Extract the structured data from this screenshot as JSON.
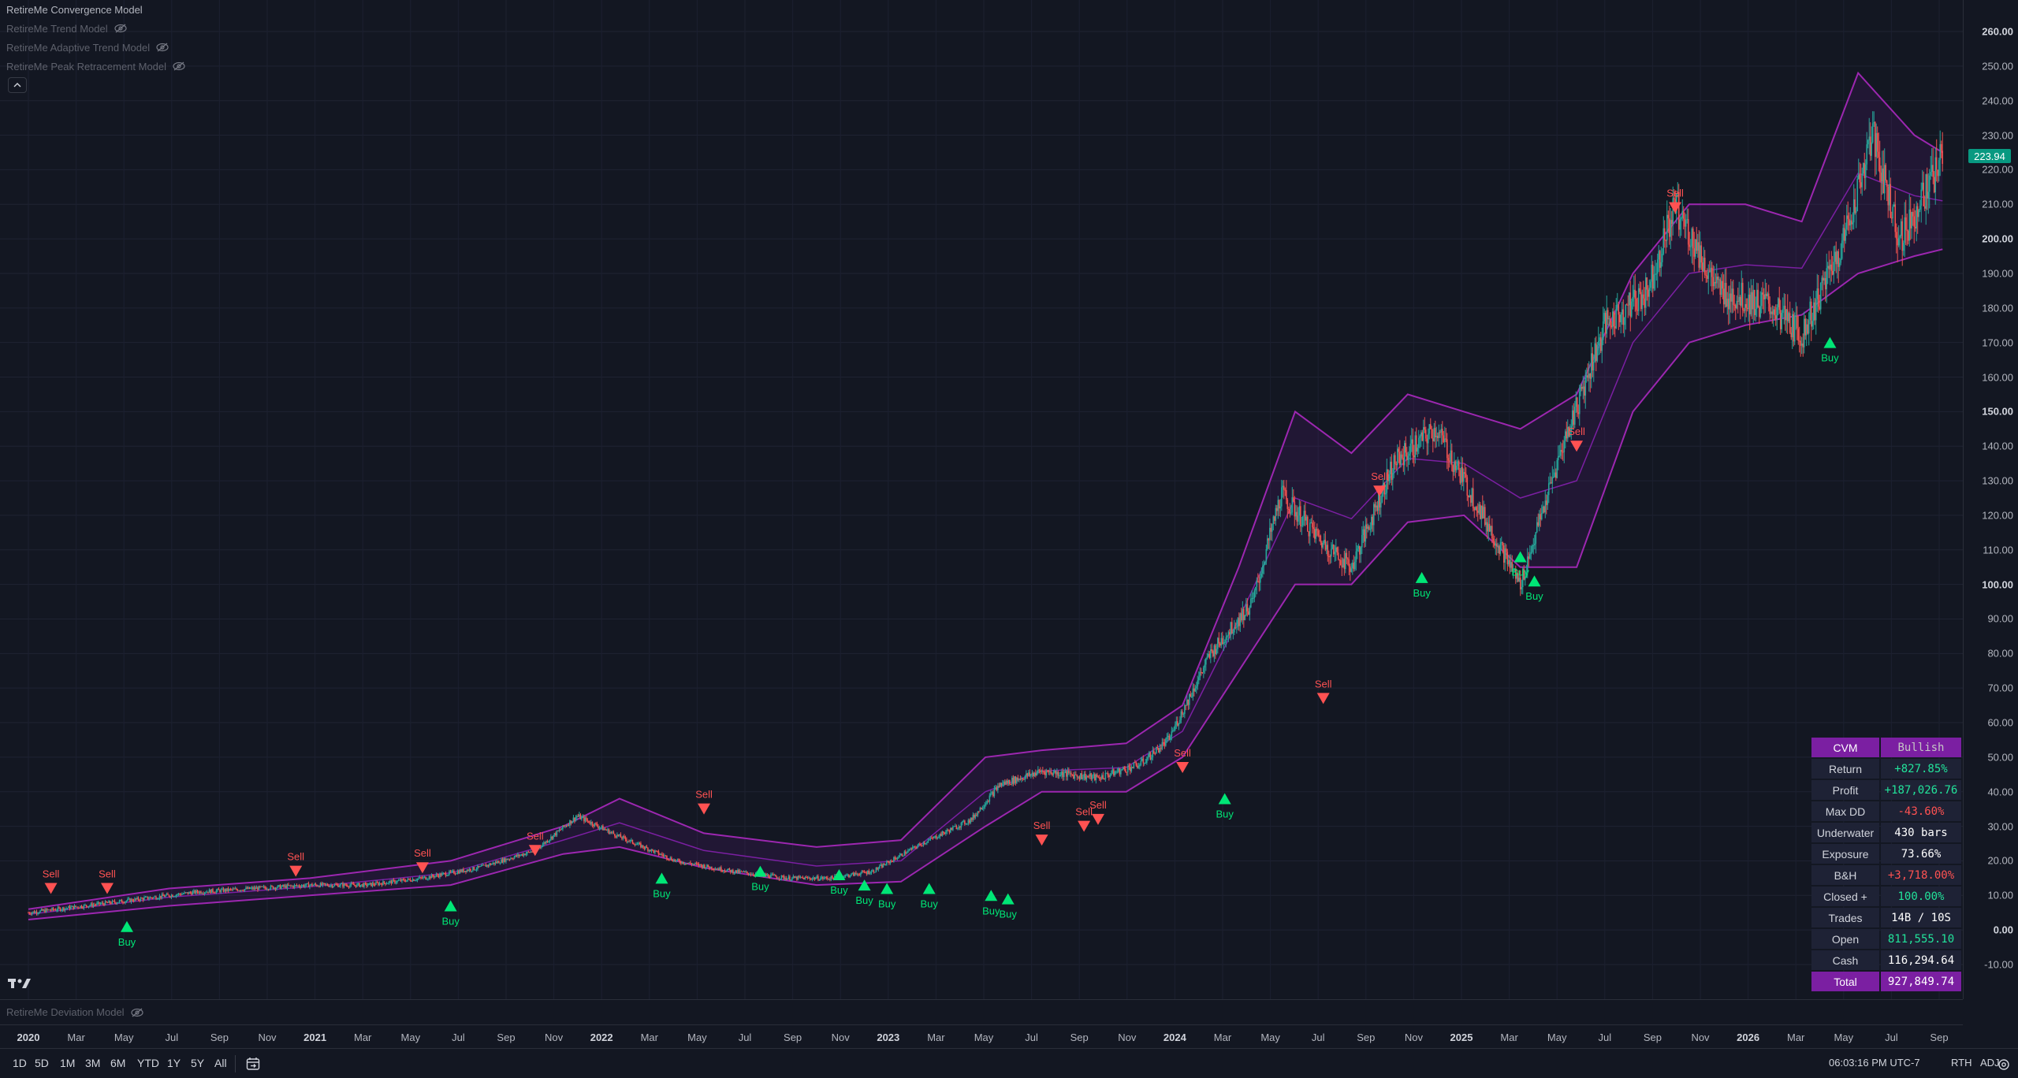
{
  "legend": {
    "main": "RetireMe Convergence Model",
    "hidden": [
      "RetireMe Trend Model",
      "RetireMe Adaptive Trend Model",
      "RetireMe Peak Retracement Model"
    ]
  },
  "sub_pane_label": "RetireMe Deviation Model",
  "current_price": "223.94",
  "price_axis": [
    "260.00",
    "250.00",
    "240.00",
    "230.00",
    "220.00",
    "210.00",
    "200.00",
    "190.00",
    "180.00",
    "170.00",
    "160.00",
    "150.00",
    "140.00",
    "130.00",
    "120.00",
    "110.00",
    "100.00",
    "90.00",
    "80.00",
    "70.00",
    "60.00",
    "50.00",
    "40.00",
    "30.00",
    "20.00",
    "10.00",
    "0.00",
    "-10.00"
  ],
  "time_axis": [
    {
      "t": "2020",
      "b": true
    },
    {
      "t": "Mar"
    },
    {
      "t": "May"
    },
    {
      "t": "Jul"
    },
    {
      "t": "Sep"
    },
    {
      "t": "Nov"
    },
    {
      "t": "2021",
      "b": true
    },
    {
      "t": "Mar"
    },
    {
      "t": "May"
    },
    {
      "t": "Jul"
    },
    {
      "t": "Sep"
    },
    {
      "t": "Nov"
    },
    {
      "t": "2022",
      "b": true
    },
    {
      "t": "Mar"
    },
    {
      "t": "May"
    },
    {
      "t": "Jul"
    },
    {
      "t": "Sep"
    },
    {
      "t": "Nov"
    },
    {
      "t": "2023",
      "b": true
    },
    {
      "t": "Mar"
    },
    {
      "t": "May"
    },
    {
      "t": "Jul"
    },
    {
      "t": "Sep"
    },
    {
      "t": "Nov"
    },
    {
      "t": "2024",
      "b": true
    },
    {
      "t": "Mar"
    },
    {
      "t": "May"
    },
    {
      "t": "Jul"
    },
    {
      "t": "Sep"
    },
    {
      "t": "Nov"
    },
    {
      "t": "2025",
      "b": true
    },
    {
      "t": "Mar"
    },
    {
      "t": "May"
    },
    {
      "t": "Jul"
    },
    {
      "t": "Sep"
    },
    {
      "t": "Nov"
    },
    {
      "t": "2026",
      "b": true
    },
    {
      "t": "Mar"
    },
    {
      "t": "May"
    },
    {
      "t": "Jul"
    },
    {
      "t": "Sep"
    }
  ],
  "timeframes": [
    "1D",
    "5D",
    "1M",
    "3M",
    "6M",
    "YTD",
    "1Y",
    "5Y",
    "All"
  ],
  "status": {
    "clock": "06:03:16 PM UTC-7",
    "session": "RTH",
    "adj": "ADJ"
  },
  "stats": {
    "head": [
      "CVM",
      "Bullish"
    ],
    "rows": [
      {
        "label": "Return",
        "value": "+827.85%",
        "tone": "pos"
      },
      {
        "label": "Profit",
        "value": "+187,026.76",
        "tone": "pos"
      },
      {
        "label": "Max DD",
        "value": "-43.60%",
        "tone": "neg"
      },
      {
        "label": "Underwater",
        "value": "430 bars",
        "tone": "neutral"
      },
      {
        "label": "Exposure",
        "value": "73.66%",
        "tone": "neutral"
      },
      {
        "label": "B&H",
        "value": "+3,718.00%",
        "tone": "neg"
      },
      {
        "label": "Closed +",
        "value": "100.00%",
        "tone": "pos"
      },
      {
        "label": "Trades",
        "value": "14B / 10S",
        "tone": "neutral"
      },
      {
        "label": "Open",
        "value": "811,555.10",
        "tone": "pos"
      },
      {
        "label": "Cash",
        "value": "116,294.64",
        "tone": "neutral"
      }
    ],
    "foot": [
      "Total",
      "927,849.74"
    ]
  },
  "signal_labels": {
    "buy": "Buy",
    "sell": "Sell"
  },
  "chart_data": {
    "type": "line",
    "ylim": [
      -15,
      265
    ],
    "price_path": [
      [
        2020.0,
        5
      ],
      [
        2020.2,
        7
      ],
      [
        2020.4,
        9
      ],
      [
        2020.6,
        11
      ],
      [
        2020.8,
        12
      ],
      [
        2021.0,
        13
      ],
      [
        2021.2,
        13
      ],
      [
        2021.4,
        15
      ],
      [
        2021.6,
        18
      ],
      [
        2021.8,
        23
      ],
      [
        2021.95,
        33
      ],
      [
        2022.1,
        27
      ],
      [
        2022.3,
        20
      ],
      [
        2022.5,
        17
      ],
      [
        2022.7,
        15
      ],
      [
        2022.85,
        15
      ],
      [
        2023.0,
        17
      ],
      [
        2023.15,
        24
      ],
      [
        2023.35,
        32
      ],
      [
        2023.45,
        42
      ],
      [
        2023.6,
        46
      ],
      [
        2023.8,
        44
      ],
      [
        2023.95,
        48
      ],
      [
        2024.05,
        55
      ],
      [
        2024.2,
        80
      ],
      [
        2024.35,
        95
      ],
      [
        2024.45,
        126
      ],
      [
        2024.6,
        112
      ],
      [
        2024.7,
        105
      ],
      [
        2024.85,
        135
      ],
      [
        2025.0,
        145
      ],
      [
        2025.1,
        130
      ],
      [
        2025.2,
        115
      ],
      [
        2025.3,
        100
      ],
      [
        2025.45,
        140
      ],
      [
        2025.6,
        175
      ],
      [
        2025.75,
        185
      ],
      [
        2025.85,
        210
      ],
      [
        2026.0,
        185
      ],
      [
        2026.2,
        180
      ],
      [
        2026.3,
        172
      ],
      [
        2026.45,
        200
      ],
      [
        2026.55,
        230
      ],
      [
        2026.65,
        200
      ],
      [
        2026.75,
        215
      ],
      [
        2026.8,
        224
      ]
    ],
    "band_upper": [
      [
        2020.0,
        6
      ],
      [
        2020.5,
        12
      ],
      [
        2021.0,
        15
      ],
      [
        2021.5,
        20
      ],
      [
        2021.9,
        30
      ],
      [
        2022.1,
        38
      ],
      [
        2022.4,
        28
      ],
      [
        2022.8,
        24
      ],
      [
        2023.1,
        26
      ],
      [
        2023.4,
        50
      ],
      [
        2023.6,
        52
      ],
      [
        2023.9,
        54
      ],
      [
        2024.1,
        65
      ],
      [
        2024.3,
        105
      ],
      [
        2024.5,
        150
      ],
      [
        2024.7,
        138
      ],
      [
        2024.9,
        155
      ],
      [
        2025.1,
        150
      ],
      [
        2025.3,
        145
      ],
      [
        2025.5,
        155
      ],
      [
        2025.7,
        190
      ],
      [
        2025.9,
        210
      ],
      [
        2026.1,
        210
      ],
      [
        2026.3,
        205
      ],
      [
        2026.5,
        248
      ],
      [
        2026.7,
        230
      ],
      [
        2026.8,
        225
      ]
    ],
    "band_lower": [
      [
        2020.0,
        3
      ],
      [
        2020.5,
        7
      ],
      [
        2021.0,
        10
      ],
      [
        2021.5,
        13
      ],
      [
        2021.9,
        22
      ],
      [
        2022.1,
        24
      ],
      [
        2022.4,
        18
      ],
      [
        2022.8,
        13
      ],
      [
        2023.1,
        14
      ],
      [
        2023.4,
        30
      ],
      [
        2023.6,
        40
      ],
      [
        2023.9,
        40
      ],
      [
        2024.1,
        50
      ],
      [
        2024.3,
        75
      ],
      [
        2024.5,
        100
      ],
      [
        2024.7,
        100
      ],
      [
        2024.9,
        118
      ],
      [
        2025.1,
        120
      ],
      [
        2025.3,
        105
      ],
      [
        2025.5,
        105
      ],
      [
        2025.7,
        150
      ],
      [
        2025.9,
        170
      ],
      [
        2026.1,
        175
      ],
      [
        2026.3,
        178
      ],
      [
        2026.5,
        190
      ],
      [
        2026.7,
        195
      ],
      [
        2026.8,
        197
      ]
    ],
    "signals": [
      {
        "kind": "sell",
        "x": 2020.08,
        "y": 12
      },
      {
        "kind": "sell",
        "x": 2020.28,
        "y": 12
      },
      {
        "kind": "buy",
        "x": 2020.35,
        "y": 1
      },
      {
        "kind": "sell",
        "x": 2020.95,
        "y": 17
      },
      {
        "kind": "sell",
        "x": 2021.4,
        "y": 18
      },
      {
        "kind": "buy",
        "x": 2021.5,
        "y": 7
      },
      {
        "kind": "sell",
        "x": 2021.8,
        "y": 23
      },
      {
        "kind": "buy",
        "x": 2022.25,
        "y": 15
      },
      {
        "kind": "sell",
        "x": 2022.4,
        "y": 35
      },
      {
        "kind": "buy",
        "x": 2022.6,
        "y": 17
      },
      {
        "kind": "buy",
        "x": 2022.88,
        "y": 16
      },
      {
        "kind": "buy",
        "x": 2022.97,
        "y": 13
      },
      {
        "kind": "buy",
        "x": 2023.05,
        "y": 12
      },
      {
        "kind": "buy",
        "x": 2023.2,
        "y": 12
      },
      {
        "kind": "buy",
        "x": 2023.42,
        "y": 10
      },
      {
        "kind": "buy",
        "x": 2023.48,
        "y": 9
      },
      {
        "kind": "sell",
        "x": 2023.6,
        "y": 26
      },
      {
        "kind": "sell",
        "x": 2023.75,
        "y": 30
      },
      {
        "kind": "sell",
        "x": 2023.8,
        "y": 32
      },
      {
        "kind": "sell",
        "x": 2024.1,
        "y": 47
      },
      {
        "kind": "buy",
        "x": 2024.25,
        "y": 38
      },
      {
        "kind": "sell",
        "x": 2024.6,
        "y": 67
      },
      {
        "kind": "sell",
        "x": 2024.8,
        "y": 127
      },
      {
        "kind": "buy",
        "x": 2024.95,
        "y": 102
      },
      {
        "kind": "buy",
        "x": 2025.3,
        "y": 108
      },
      {
        "kind": "buy",
        "x": 2025.35,
        "y": 101
      },
      {
        "kind": "sell",
        "x": 2025.5,
        "y": 140
      },
      {
        "kind": "sell",
        "x": 2025.85,
        "y": 209
      },
      {
        "kind": "buy",
        "x": 2026.4,
        "y": 170
      }
    ]
  }
}
